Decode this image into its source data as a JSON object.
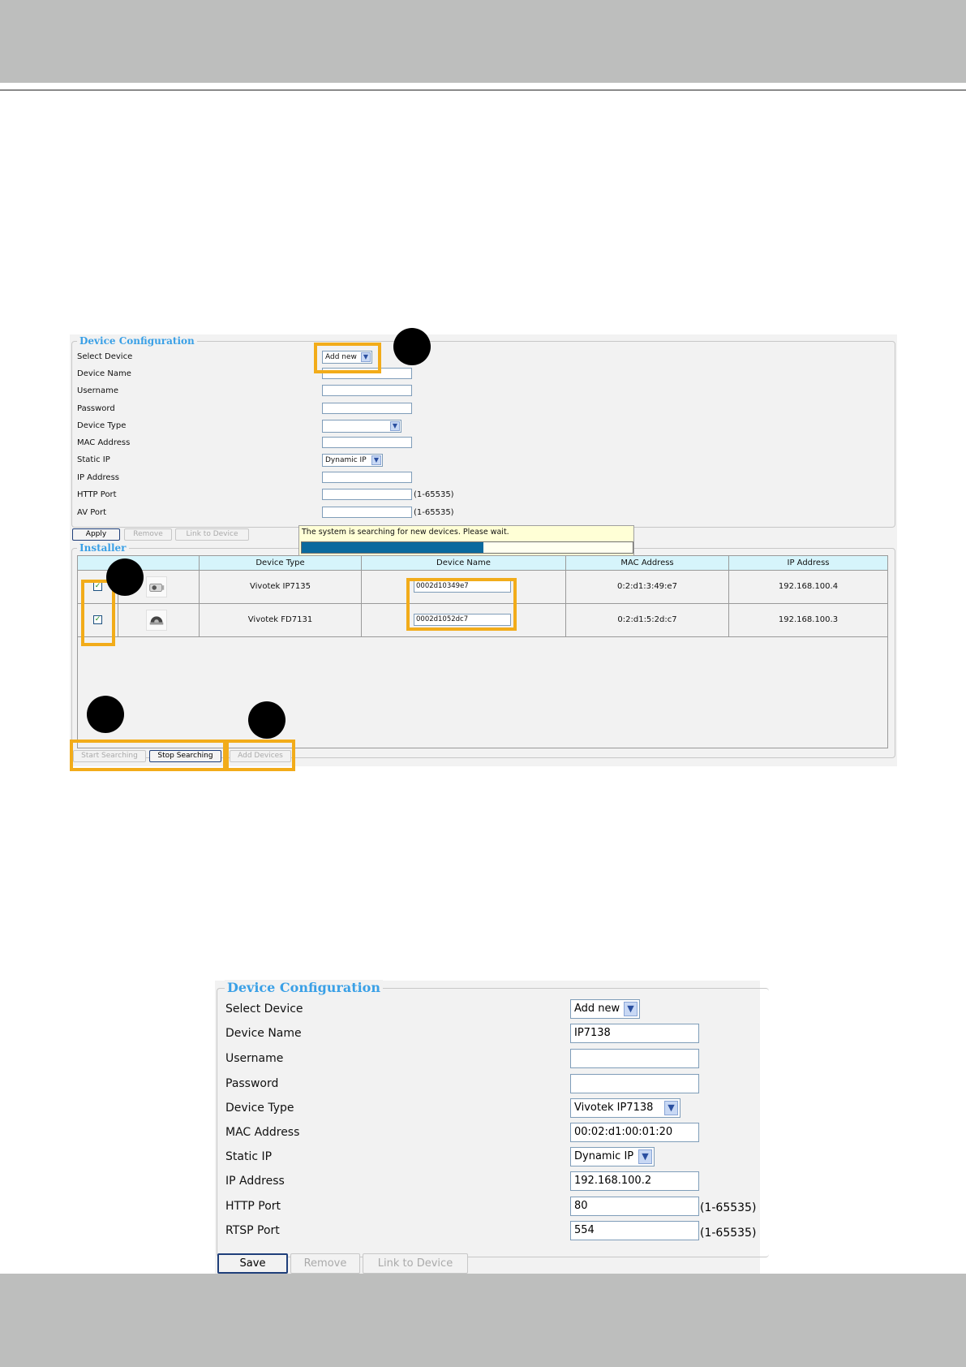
{
  "colors": {
    "highlight": "#f2ac1a",
    "legend": "#3aa0e6",
    "table_header": "#d6f4fb",
    "progress": "#0a6a9e",
    "page_band": "#bdbebd"
  },
  "screenshot1": {
    "device_config": {
      "legend": "Device Configuration",
      "labels": [
        "Select Device",
        "Device Name",
        "Username",
        "Password",
        "Device Type",
        "MAC Address",
        "Static IP",
        "IP Address",
        "HTTP Port",
        "AV Port"
      ],
      "select_device": "Add new",
      "static_ip": "Dynamic IP",
      "port_range": "(1-65535)"
    },
    "buttons": {
      "apply": "Apply",
      "remove": "Remove",
      "link": "Link to Device"
    },
    "progress": {
      "text": "The system is searching for new devices. Please wait.",
      "fraction": 0.55
    },
    "installer": {
      "legend": "Installer",
      "headers": [
        "Device Type",
        "Device Name",
        "MAC Address",
        "IP Address"
      ],
      "rows": [
        {
          "type": "Vivotek IP7135",
          "name": "0002d10349e7",
          "mac": "0:2:d1:3:49:e7",
          "ip": "192.168.100.4",
          "checked": true,
          "thumb": "camera-icon"
        },
        {
          "type": "Vivotek FD7131",
          "name": "0002d1052dc7",
          "mac": "0:2:d1:5:2d:c7",
          "ip": "192.168.100.3",
          "checked": true,
          "thumb": "dome-camera-icon"
        }
      ]
    },
    "search_buttons": {
      "start": "Start Searching",
      "stop": "Stop Searching",
      "add": "Add Devices"
    }
  },
  "screenshot2": {
    "legend": "Device Configuration",
    "fields": [
      {
        "label": "Select Device",
        "value": "Add new"
      },
      {
        "label": "Device Name",
        "value": "IP7138"
      },
      {
        "label": "Username",
        "value": ""
      },
      {
        "label": "Password",
        "value": ""
      },
      {
        "label": "Device Type",
        "value": "Vivotek IP7138"
      },
      {
        "label": "MAC Address",
        "value": "00:02:d1:00:01:20"
      },
      {
        "label": "Static IP",
        "value": "Dynamic IP"
      },
      {
        "label": "IP Address",
        "value": "192.168.100.2"
      },
      {
        "label": "HTTP Port",
        "value": "80"
      },
      {
        "label": "RTSP Port",
        "value": "554"
      }
    ],
    "port_range": "(1-65535)",
    "buttons": {
      "save": "Save",
      "remove": "Remove",
      "link": "Link to Device"
    }
  }
}
